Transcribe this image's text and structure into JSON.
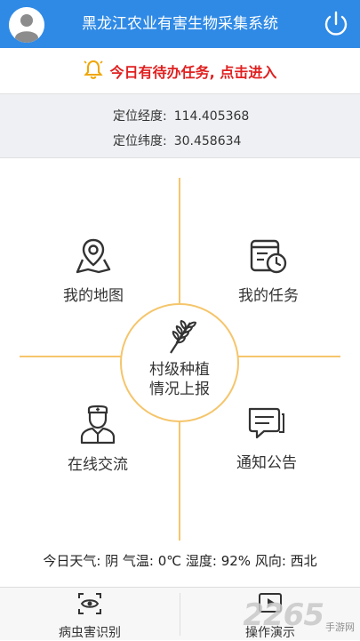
{
  "header": {
    "title": "黑龙江农业有害生物采集系统",
    "avatar_icon": "user-avatar-icon",
    "power_icon": "power-icon"
  },
  "todo": {
    "text": "今日有待办任务, 点击进入",
    "icon": "bell-icon",
    "color": "#e02020"
  },
  "location": {
    "lng_label": "定位经度:",
    "lng_value": "114.405368",
    "lat_label": "定位纬度:",
    "lat_value": "30.458634"
  },
  "menu": {
    "map": "我的地图",
    "task": "我的任务",
    "center_line1": "村级种植",
    "center_line2": "情况上报",
    "chat": "在线交流",
    "notice": "通知公告"
  },
  "weather": {
    "text": "今日天气: 阴  气温: 0℃  湿度: 92%  风向: 西北"
  },
  "tabs": {
    "left": "病虫害识别",
    "right": "操作演示"
  },
  "watermark": {
    "number": "2265",
    "text": "手游网"
  },
  "colors": {
    "header_bg": "#2f8ae6",
    "accent_line": "#f5c56b",
    "alert": "#e02020",
    "bell": "#f0a500"
  }
}
